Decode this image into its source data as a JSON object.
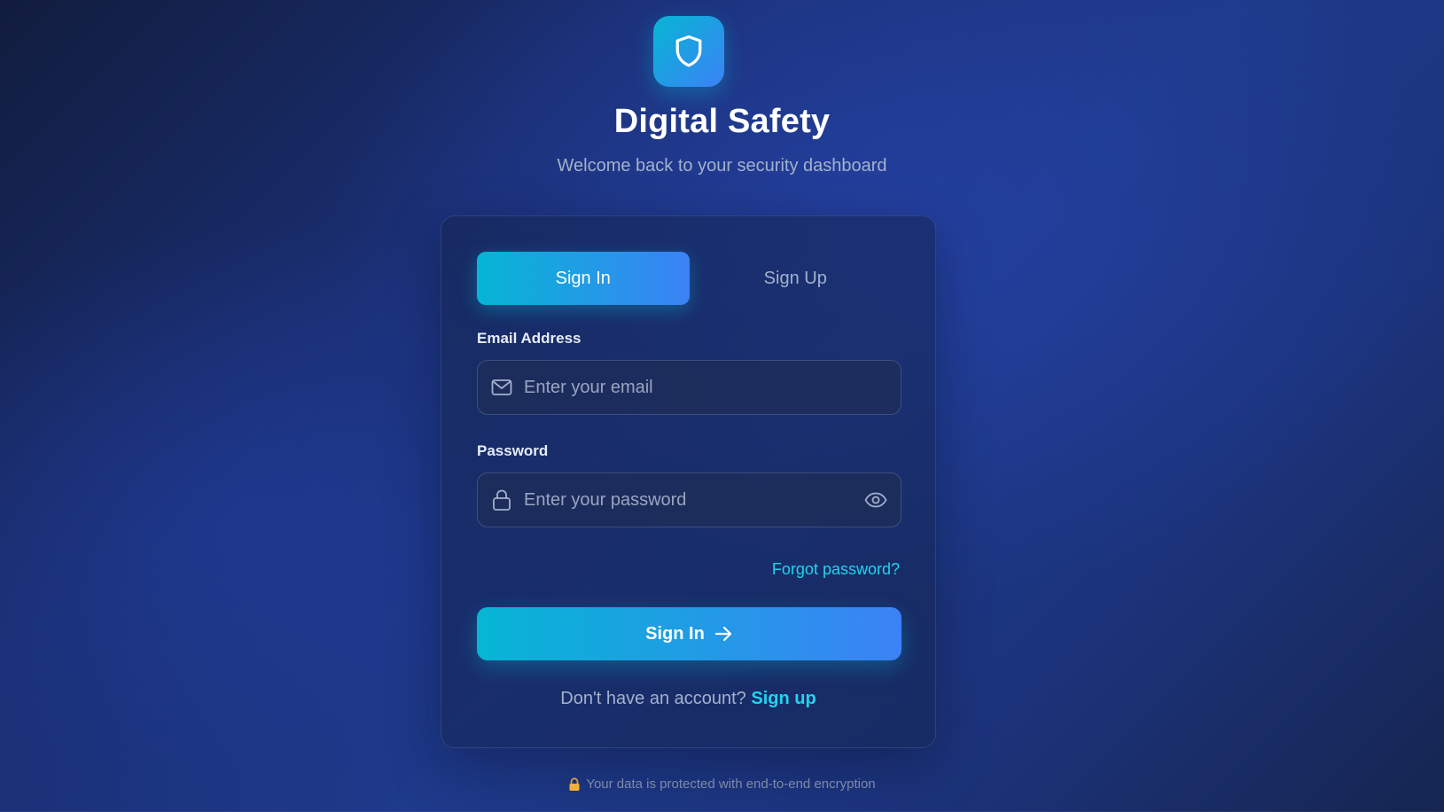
{
  "brand": {
    "title": "Digital Safety",
    "subtitle": "Welcome back to your security dashboard",
    "logo_icon": "shield-icon"
  },
  "tabs": [
    {
      "label": "Sign In",
      "active": true
    },
    {
      "label": "Sign Up",
      "active": false
    }
  ],
  "form": {
    "email": {
      "label": "Email Address",
      "placeholder": "Enter your email",
      "value": "",
      "icon": "mail-icon"
    },
    "password": {
      "label": "Password",
      "placeholder": "Enter your password",
      "value": "",
      "icon": "lock-icon",
      "toggle_icon": "eye-icon"
    },
    "forgot_label": "Forgot password?",
    "submit_label": "Sign In",
    "submit_icon": "arrow-right-icon"
  },
  "signup_prompt": {
    "text": "Don't have an account?",
    "link_label": "Sign up"
  },
  "footer": {
    "icon": "padlock-icon",
    "text": "Your data is protected with end-to-end encryption"
  },
  "colors": {
    "accent_start": "#06b6d4",
    "accent_end": "#3b82f6",
    "link": "#22d3ee",
    "background": "#1e3a8a"
  }
}
